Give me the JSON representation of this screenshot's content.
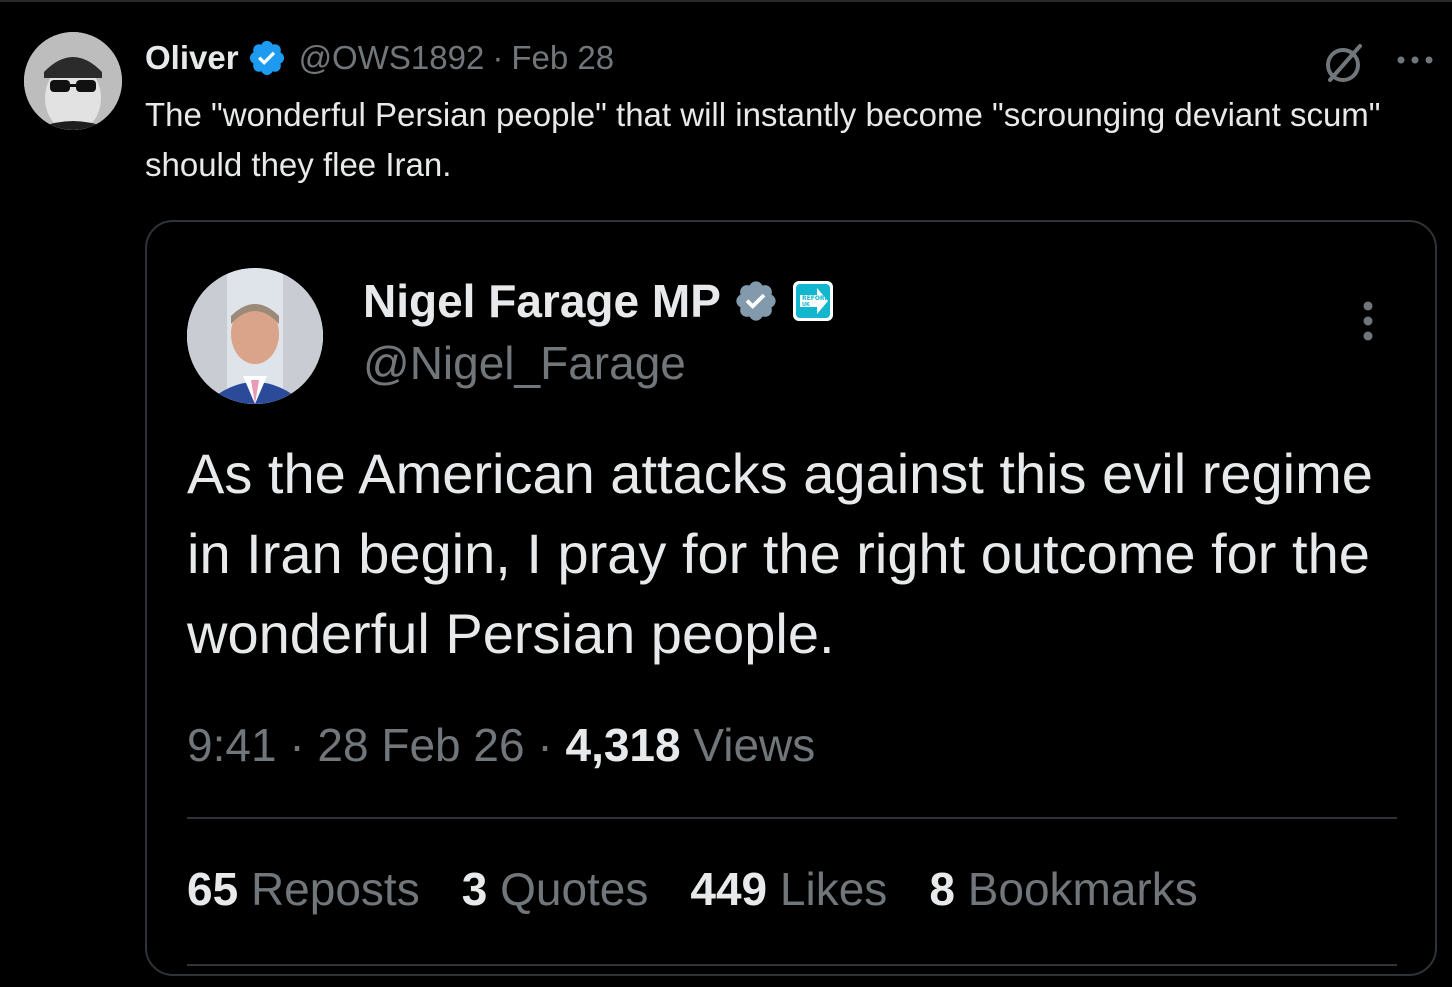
{
  "outer_tweet": {
    "author_name": "Oliver",
    "handle": "@OWS1892",
    "separator": "·",
    "date": "Feb 28",
    "text": "The \"wonderful Persian people\" that will instantly become \"scrounging deviant scum\" should they flee Iran."
  },
  "quoted_tweet": {
    "author_name": "Nigel Farage MP",
    "handle": "@Nigel_Farage",
    "badge_text": "REFORM UK",
    "text": "As the American attacks against this evil regime in Iran begin, I pray for the right outcome for the wonderful Persian people.",
    "time": "9:41",
    "separator": "·",
    "date": "28 Feb 26",
    "views_count": "4,318",
    "views_label": "Views",
    "stats": [
      {
        "count": "65",
        "label": "Reposts"
      },
      {
        "count": "3",
        "label": "Quotes"
      },
      {
        "count": "449",
        "label": "Likes"
      },
      {
        "count": "8",
        "label": "Bookmarks"
      }
    ]
  },
  "colors": {
    "background": "#000000",
    "primary_text": "#e7e9ea",
    "secondary_text": "#71767b",
    "border": "#2f3336",
    "verified_blue": "#1d9bf0",
    "verified_grey": "#829aab",
    "reform_blue": "#12b6cf"
  },
  "icons": [
    "verified-icon",
    "grok-icon",
    "more-icon",
    "reform-badge-icon"
  ]
}
